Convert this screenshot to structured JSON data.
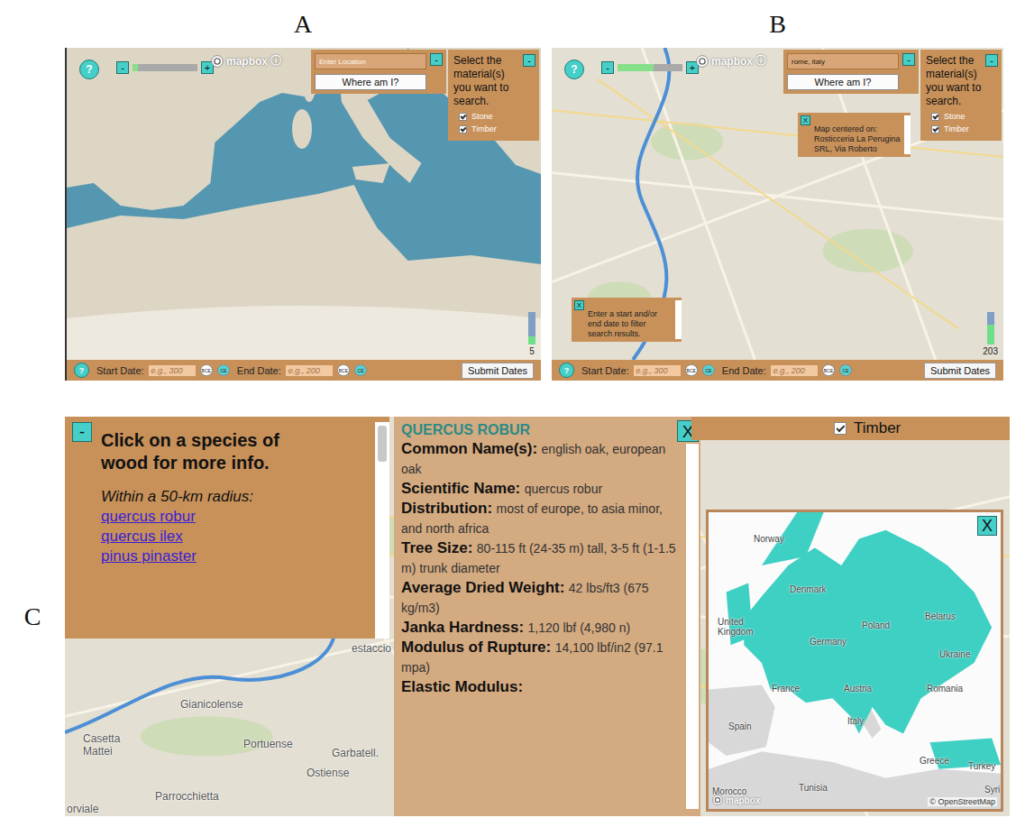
{
  "figure_labels": {
    "a": "A",
    "b": "B",
    "c": "C"
  },
  "panels": [
    {
      "label": "A",
      "map": "region",
      "help": "?",
      "zoom": {
        "minus": "-",
        "plus": "+",
        "level": 0.08
      },
      "attribution": {
        "text": "mapbox",
        "info": "ⓘ"
      },
      "search": {
        "text": "Enter Location",
        "is_placeholder": true,
        "button": "Where am I?",
        "collapse": "-"
      },
      "materials": {
        "title": "Select the material(s) you want to search.",
        "collapse": "-",
        "options": [
          {
            "label": "Stone",
            "checked": true
          },
          {
            "label": "Timber",
            "checked": true
          }
        ]
      },
      "popups": [],
      "count": {
        "value": "5",
        "level": 0.25
      },
      "dates": {
        "help": "?",
        "start_label": "Start Date:",
        "start_placeholder": "e.g., 300",
        "end_label": "End Date:",
        "end_placeholder": "e.g., 200",
        "start_eras": [
          {
            "label": "BCE",
            "selected": false
          },
          {
            "label": "CE",
            "selected": true
          }
        ],
        "end_eras": [
          {
            "label": "BCE",
            "selected": false
          },
          {
            "label": "CE",
            "selected": true
          }
        ],
        "submit": "Submit Dates"
      }
    },
    {
      "label": "B",
      "map": "city",
      "help": "?",
      "zoom": {
        "minus": "-",
        "plus": "+",
        "level": 0.55
      },
      "attribution": {
        "text": "mapbox",
        "info": "ⓘ"
      },
      "search": {
        "text": "rome, italy",
        "is_placeholder": false,
        "button": "Where am I?",
        "collapse": "-"
      },
      "materials": {
        "title": "Select the material(s) you want to search.",
        "collapse": "-",
        "options": [
          {
            "label": "Stone",
            "checked": true
          },
          {
            "label": "Timber",
            "checked": true
          }
        ]
      },
      "popups": [
        {
          "kind": "location",
          "close": "X",
          "text": "Map centered on: Rosticceria La Perugina SRL, Via Roberto"
        },
        {
          "kind": "dates",
          "close": "X",
          "text": "Enter a start and/or end date to filter search results."
        }
      ],
      "count": {
        "value": "203",
        "level": 0.6
      },
      "dates": {
        "help": "?",
        "start_label": "Start Date:",
        "start_placeholder": "e.g., 300",
        "end_label": "End Date:",
        "end_placeholder": "e.g., 200",
        "start_eras": [
          {
            "label": "BCE",
            "selected": false
          },
          {
            "label": "CE",
            "selected": true
          }
        ],
        "end_eras": [
          {
            "label": "BCE",
            "selected": false
          },
          {
            "label": "CE",
            "selected": true
          }
        ],
        "submit": "Submit Dates"
      }
    }
  ],
  "detail": {
    "label": "C",
    "list_panel": {
      "collapse": "-",
      "title": "Click on a species of wood for more info.",
      "subtitle": "Within a 50-km radius:",
      "species": [
        "quercus robur",
        "quercus ilex",
        "pinus pinaster"
      ]
    },
    "info": {
      "title": "QUERCUS ROBUR",
      "close": "X",
      "fields": [
        {
          "label": "Common Name(s):",
          "value": "english oak, european oak"
        },
        {
          "label": "Scientific Name:",
          "value": "quercus robur"
        },
        {
          "label": "Distribution:",
          "value": "most of europe, to asia minor, and north africa"
        },
        {
          "label": "Tree Size:",
          "value": "80-115 ft (24-35 m) tall, 3-5 ft (1-1.5 m) trunk diameter"
        },
        {
          "label": "Average Dried Weight:",
          "value": "42 lbs/ft3 (675 kg/m3)"
        },
        {
          "label": "Janka Hardness:",
          "value": "1,120 lbf (4,980 n)"
        },
        {
          "label": "Modulus of Rupture:",
          "value": "14,100 lbf/in2 (97.1 mpa)"
        },
        {
          "label": "Elastic Modulus:",
          "value": ""
        }
      ]
    },
    "material_option": {
      "label": "Timber",
      "checked": true
    },
    "street_labels": [
      "Gianicolense",
      "Casetta Mattei",
      "Portuense",
      "Garbatell.",
      "Ostiense",
      "Parrocchietta",
      "estaccio",
      "orviale"
    ],
    "range_map": {
      "close": "X",
      "logo": "mapbox",
      "attribution": "© OpenStreetMap",
      "labels": [
        "Norway",
        "Denmark",
        "United Kingdom",
        "Germany",
        "Poland",
        "Belarus",
        "Ukraine",
        "France",
        "Austria",
        "Romania",
        "Italy",
        "Spain",
        "Greece",
        "Turkey",
        "Morocco",
        "Tunisia",
        "Syri"
      ]
    }
  }
}
